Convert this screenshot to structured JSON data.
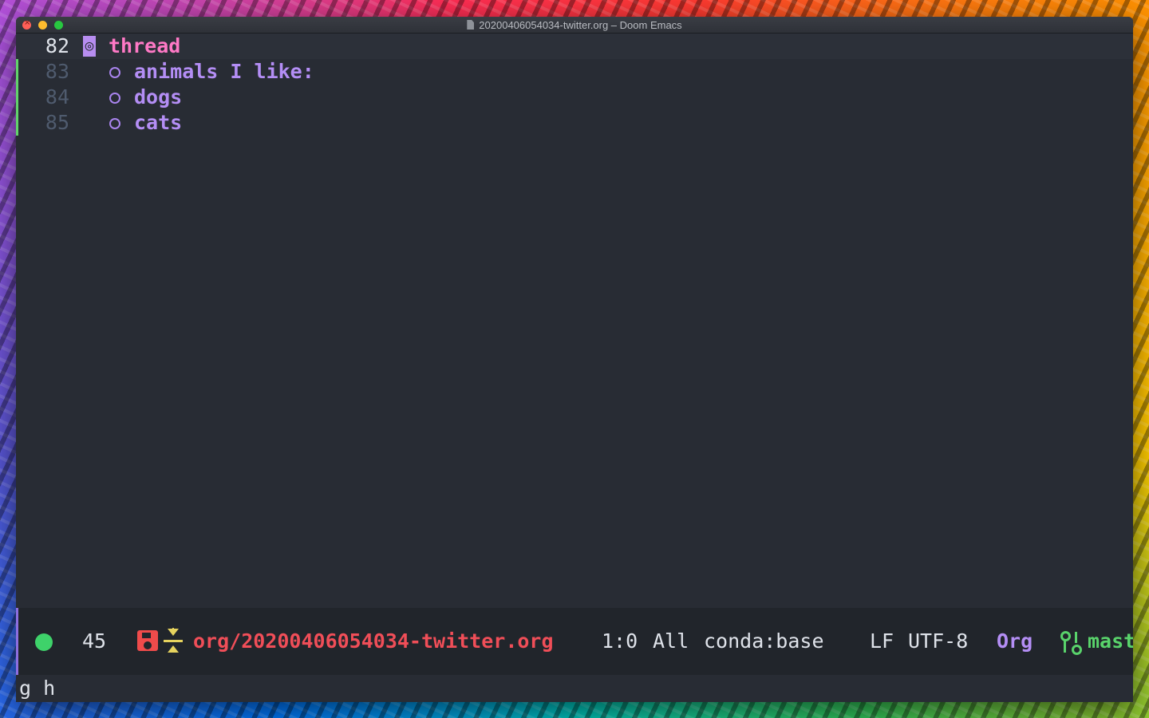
{
  "window": {
    "title": "20200406054034-twitter.org – Doom Emacs",
    "file_icon": "document-icon"
  },
  "editor": {
    "lines": [
      {
        "number": "82",
        "cursor_char": "◎",
        "text": "thread"
      },
      {
        "number": "83",
        "bullet": "○",
        "text": "animals I like:"
      },
      {
        "number": "84",
        "bullet": "○",
        "text": "dogs"
      },
      {
        "number": "85",
        "bullet": "○",
        "text": "cats"
      }
    ]
  },
  "modeline": {
    "status_icon": "green-dot-icon",
    "count": "45",
    "save_icon": "floppy-disk-icon",
    "narrow_icon": "narrow-arrows-icon",
    "file_path": "org/20200406054034-twitter.org",
    "position": "1:0",
    "scroll": "All",
    "env": "conda:base",
    "eol": "LF",
    "encoding": "UTF-8",
    "major_mode": "Org",
    "vcs_icon": "git-compare-icon",
    "branch": "mast"
  },
  "minibuffer": {
    "text": "g h"
  },
  "colors": {
    "background": "#282c34",
    "heading": "#ff79c6",
    "list_item": "#b48ef5",
    "file_path": "#f04e58",
    "branch": "#59d36b",
    "gutter_indicator": "#61d36b"
  }
}
